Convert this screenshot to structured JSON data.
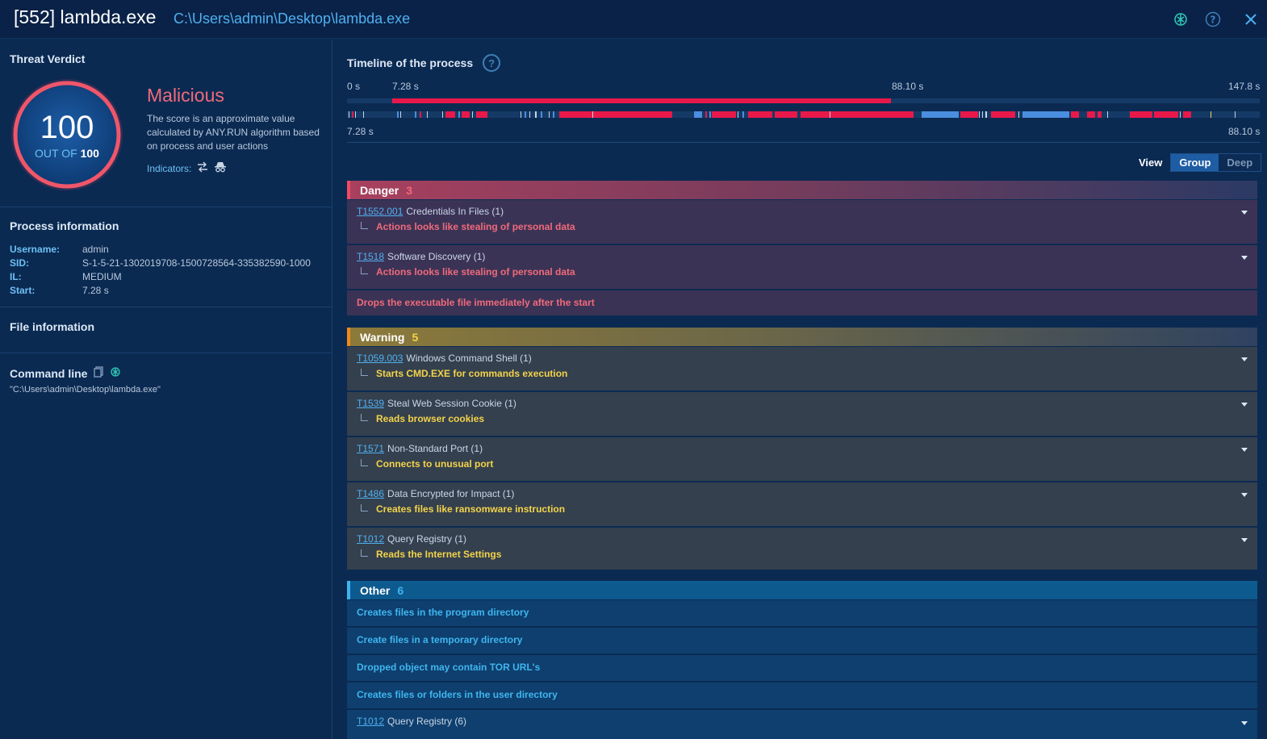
{
  "header": {
    "pid_title": "[552] lambda.exe",
    "path": "C:\\Users\\admin\\Desktop\\lambda.exe",
    "icons": [
      "ai-assistant-icon",
      "help-icon",
      "close-icon"
    ]
  },
  "left": {
    "threat_verdict_title": "Threat Verdict",
    "score": "100",
    "out_of_label": "OUT OF",
    "out_of_value": "100",
    "verdict": "Malicious",
    "verdict_desc": "The score is an approximate value calculated by ANY.RUN algorithm based on process and user actions",
    "indicators_label": "Indicators:",
    "process_info_title": "Process information",
    "process_info": [
      {
        "key": "Username:",
        "value": "admin"
      },
      {
        "key": "SID:",
        "value": "S-1-5-21-1302019708-1500728564-335382590-1000"
      },
      {
        "key": "IL:",
        "value": "MEDIUM"
      },
      {
        "key": "Start:",
        "value": "7.28 s"
      }
    ],
    "file_info_title": "File information",
    "cmdline_title": "Command line",
    "cmdline_value": "\"C:\\Users\\admin\\Desktop\\lambda.exe\""
  },
  "timeline": {
    "title": "Timeline of the process",
    "tick_start": "0 s",
    "tick_process_start": "7.28 s",
    "tick_process_end": "88.10 s",
    "tick_end": "147.8 s",
    "zoom_start": "7.28 s",
    "zoom_end": "88.10 s",
    "total_seconds": 147.8,
    "process_range": [
      7.28,
      88.1
    ],
    "colors": {
      "danger": "#e8194a",
      "other": "#4a8ee0",
      "warning": "#f3d34a",
      "neutral": "#c9d6e6"
    }
  },
  "view": {
    "label": "View",
    "options": [
      "Group",
      "Deep"
    ],
    "selected": "Group"
  },
  "groups": {
    "danger": {
      "label": "Danger",
      "count": "3",
      "rows": [
        {
          "id": "T1552.001",
          "name": "Credentials In Files (1)",
          "detail": "Actions looks like stealing of personal data"
        },
        {
          "id": "T1518",
          "name": "Software Discovery (1)",
          "detail": "Actions looks like stealing of personal data"
        }
      ],
      "single": "Drops the executable file immediately after the start"
    },
    "warning": {
      "label": "Warning",
      "count": "5",
      "rows": [
        {
          "id": "T1059.003",
          "name": "Windows Command Shell (1)",
          "detail": "Starts CMD.EXE for commands execution"
        },
        {
          "id": "T1539",
          "name": "Steal Web Session Cookie (1)",
          "detail": "Reads browser cookies"
        },
        {
          "id": "T1571",
          "name": "Non-Standard Port (1)",
          "detail": "Connects to unusual port"
        },
        {
          "id": "T1486",
          "name": "Data Encrypted for Impact (1)",
          "detail": "Creates files like ransomware instruction"
        },
        {
          "id": "T1012",
          "name": "Query Registry (1)",
          "detail": "Reads the Internet Settings"
        }
      ]
    },
    "other": {
      "label": "Other",
      "count": "6",
      "singles": [
        "Creates files in the program directory",
        "Create files in a temporary directory",
        "Dropped object may contain TOR URL's",
        "Creates files or folders in the user directory"
      ],
      "rows": [
        {
          "id": "T1012",
          "name": "Query Registry (6)"
        }
      ]
    }
  }
}
